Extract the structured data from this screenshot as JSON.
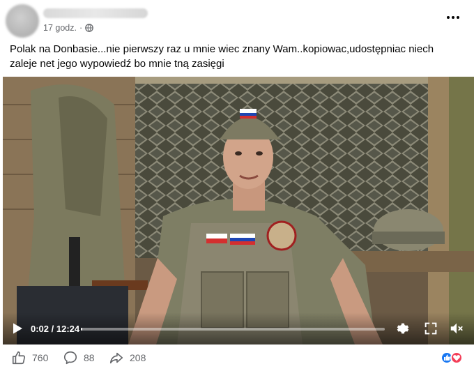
{
  "post": {
    "time": "17 godz.",
    "separator": "·",
    "privacy_icon": "globe-icon",
    "text": "Polak na Donbasie...nie pierwszy raz u mnie wiec znany Wam..kopiowac,udostępniac niech zaleje net jego wypowiedź bo mnie tną zasięgi"
  },
  "video": {
    "time_display": "0:02 / 12:24",
    "progress_fraction": 0.003,
    "icons": [
      "play-icon",
      "settings-icon",
      "fullscreen-icon",
      "mute-icon"
    ]
  },
  "footer": {
    "likes": "760",
    "comments": "88",
    "shares": "208",
    "reaction_icons": [
      "like-reaction-icon",
      "love-reaction-icon"
    ]
  },
  "colors": {
    "text_secondary": "#65676b",
    "like_blue": "#1877f2",
    "love_red": "#f33e58"
  }
}
